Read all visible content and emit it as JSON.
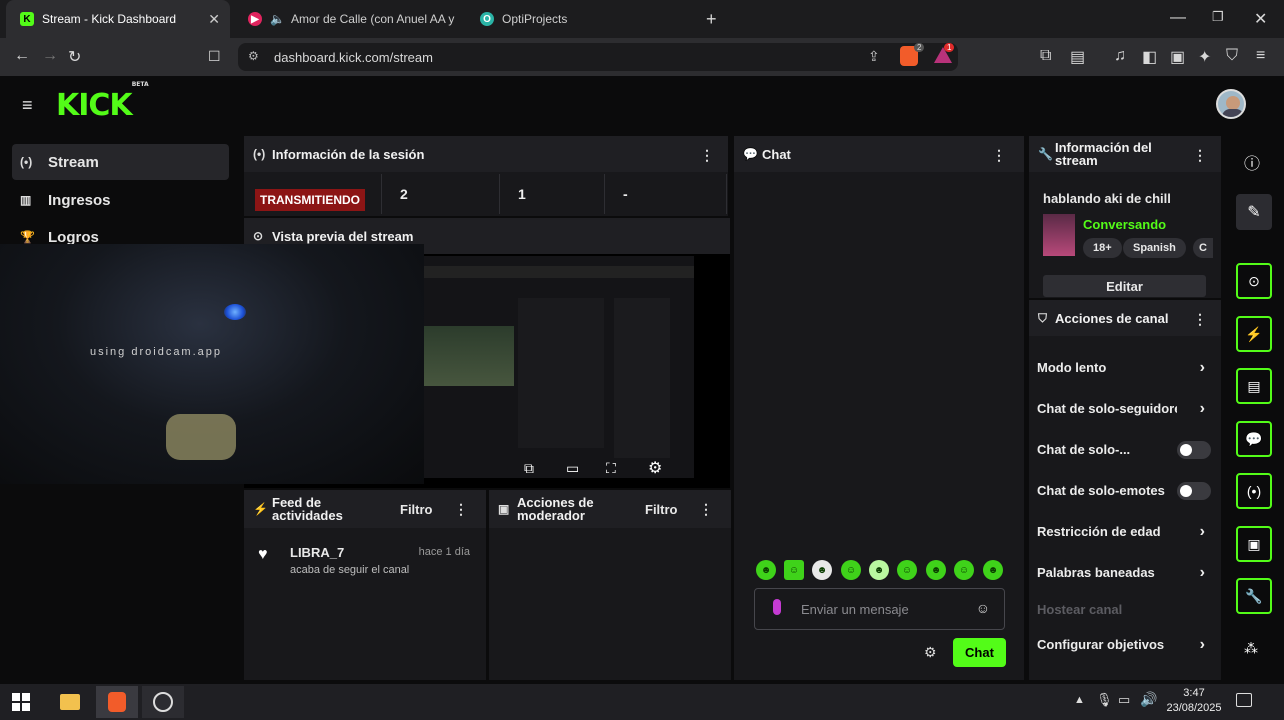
{
  "browser": {
    "tabs": [
      {
        "title": "Stream - Kick Dashboard",
        "active": true
      },
      {
        "title": "Amor de Calle (con Anuel AA y A",
        "active": false
      },
      {
        "title": "OptiProjects",
        "active": false
      }
    ],
    "url": "dashboard.kick.com/stream",
    "brave_badge": "2",
    "alert_badge": "1"
  },
  "brand": {
    "logo": "KICK",
    "beta": "BETA",
    "accent": "#53fc18"
  },
  "sidebar": {
    "items": [
      {
        "label": "Stream",
        "icon": "broadcast-icon"
      },
      {
        "label": "Ingresos",
        "icon": "chart-icon"
      },
      {
        "label": "Logros",
        "icon": "trophy-icon"
      }
    ]
  },
  "session": {
    "title": "Información de la sesión",
    "status": "TRANSMITIENDO",
    "stats": [
      "2",
      "1",
      "-"
    ]
  },
  "preview": {
    "title": "Vista previa del stream",
    "overlay_text": "using droidcam.app"
  },
  "feed": {
    "title": "Feed de actividades",
    "filter": "Filtro",
    "items": [
      {
        "user": "LIBRA_7",
        "time": "hace 1 día",
        "text": "acaba de seguir el canal"
      }
    ]
  },
  "mod_actions": {
    "title": "Acciones de moderador",
    "filter": "Filtro"
  },
  "chat": {
    "title": "Chat",
    "placeholder": "Enviar un mensaje",
    "send": "Chat"
  },
  "stream_info": {
    "title": "Información del stream",
    "stream_title": "hablando aki de chill",
    "category": "Conversando",
    "tags": [
      "18+",
      "Spanish",
      "C"
    ],
    "edit": "Editar"
  },
  "channel_actions": {
    "title": "Acciones de canal",
    "items": [
      {
        "label": "Modo lento",
        "control": "chevron"
      },
      {
        "label": "Chat de solo-seguidore:",
        "control": "chevron"
      },
      {
        "label": "Chat de solo-...",
        "control": "toggle"
      },
      {
        "label": "Chat de solo-emotes",
        "control": "toggle"
      },
      {
        "label": "Restricción de edad",
        "control": "chevron"
      },
      {
        "label": "Palabras baneadas",
        "control": "chevron"
      },
      {
        "label": "Hostear canal",
        "control": "disabled"
      },
      {
        "label": "Configurar objetivos",
        "control": "chevron"
      }
    ]
  },
  "taskbar": {
    "time": "3:47",
    "date": "23/08/2025"
  }
}
